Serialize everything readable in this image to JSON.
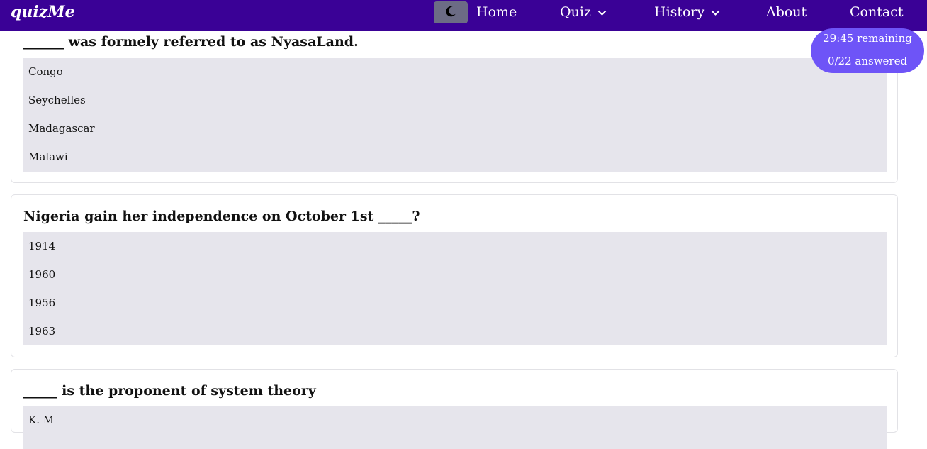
{
  "nav": {
    "brand": "quizMe",
    "theme_icon": "moon-icon",
    "links": [
      {
        "label": "Home",
        "dropdown": false
      },
      {
        "label": "Quiz",
        "dropdown": true
      },
      {
        "label": "History",
        "dropdown": true
      },
      {
        "label": "About",
        "dropdown": false
      },
      {
        "label": "Contact",
        "dropdown": false
      }
    ]
  },
  "timer": {
    "remaining": "29:45 remaining",
    "answered": "0/22 answered"
  },
  "questions": [
    {
      "text": "______ was formely referred to as NyasaLand.",
      "options": [
        "Congo",
        "Seychelles",
        "Madagascar",
        "Malawi"
      ]
    },
    {
      "text": "Nigeria gain her independence on October 1st _____?",
      "options": [
        "1914",
        "1960",
        "1956",
        "1963"
      ]
    },
    {
      "text": "_____ is the proponent of system theory",
      "options": [
        "K. M"
      ]
    }
  ],
  "colors": {
    "navbar": "#3a0196",
    "timer": "#6e54f7",
    "option_bg": "#e6e5ec",
    "toggle_bg": "#6c6c85"
  }
}
